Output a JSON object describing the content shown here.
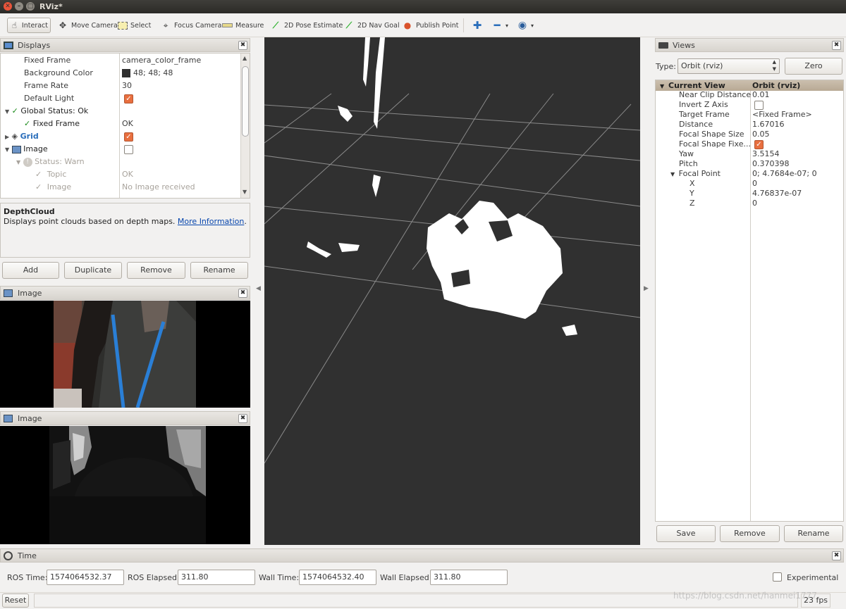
{
  "window": {
    "title": "RViz*"
  },
  "toolbar": {
    "tools": [
      {
        "label": "Interact",
        "icon": "hand-pointer-icon"
      },
      {
        "label": "Move Camera",
        "icon": "move-arrows-icon"
      },
      {
        "label": "Select",
        "icon": "select-rect-icon"
      },
      {
        "label": "Focus Camera",
        "icon": "crosshair-icon"
      },
      {
        "label": "Measure",
        "icon": "ruler-icon"
      },
      {
        "label": "2D Pose Estimate",
        "icon": "green-arrow-icon"
      },
      {
        "label": "2D Nav Goal",
        "icon": "green-arrow-icon"
      },
      {
        "label": "Publish Point",
        "icon": "map-pin-icon"
      }
    ]
  },
  "displays": {
    "title": "Displays",
    "rows": [
      {
        "label": "Fixed Frame",
        "value": "camera_color_frame"
      },
      {
        "label": "Background Color",
        "value": "48; 48; 48"
      },
      {
        "label": "Frame Rate",
        "value": "30"
      },
      {
        "label": "Default Light",
        "value": ""
      },
      {
        "label": "Global Status: Ok",
        "value": ""
      },
      {
        "label": "Fixed Frame",
        "value": "OK"
      },
      {
        "label": "Grid",
        "value": ""
      },
      {
        "label": "Image",
        "value": ""
      },
      {
        "label": "Status: Warn",
        "value": ""
      },
      {
        "label": "Topic",
        "value": "OK"
      },
      {
        "label": "Image",
        "value": "No Image received"
      }
    ],
    "desc_title": "DepthCloud",
    "desc_text": "Displays point clouds based on depth maps.",
    "desc_link": "More Information",
    "desc_period": ".",
    "buttons": {
      "add": "Add",
      "duplicate": "Duplicate",
      "remove": "Remove",
      "rename": "Rename"
    }
  },
  "image_panel_1": {
    "title": "Image"
  },
  "image_panel_2": {
    "title": "Image"
  },
  "views": {
    "title": "Views",
    "type_label": "Type:",
    "type_value": "Orbit (rviz)",
    "zero": "Zero",
    "header": {
      "name": "Current View",
      "value": "Orbit (rviz)"
    },
    "rows": [
      {
        "label": "Near Clip Distance",
        "value": "0.01"
      },
      {
        "label": "Invert Z Axis",
        "value": ""
      },
      {
        "label": "Target Frame",
        "value": "<Fixed Frame>"
      },
      {
        "label": "Distance",
        "value": "1.67016"
      },
      {
        "label": "Focal Shape Size",
        "value": "0.05"
      },
      {
        "label": "Focal Shape Fixe...",
        "value": ""
      },
      {
        "label": "Yaw",
        "value": "3.5154"
      },
      {
        "label": "Pitch",
        "value": "0.370398"
      },
      {
        "label": "Focal Point",
        "value": "0; 4.7684e-07; 0"
      },
      {
        "label": "X",
        "value": "0"
      },
      {
        "label": "Y",
        "value": "4.76837e-07"
      },
      {
        "label": "Z",
        "value": "0"
      }
    ],
    "buttons": {
      "save": "Save",
      "remove": "Remove",
      "rename": "Rename"
    }
  },
  "time": {
    "title": "Time",
    "ros_time_label": "ROS Time:",
    "ros_time": "1574064532.37",
    "ros_elapsed_label": "ROS Elapsed:",
    "ros_elapsed": "311.80",
    "wall_time_label": "Wall Time:",
    "wall_time": "1574064532.40",
    "wall_elapsed_label": "Wall Elapsed:",
    "wall_elapsed": "311.80",
    "experimental": "Experimental"
  },
  "status": {
    "reset": "Reset",
    "fps": "23 fps",
    "watermark": "https://blog.csdn.net/hanmei1777"
  },
  "colors": {
    "viewport_bg": "#303030",
    "checkbox_on": "#e86f3f",
    "link": "#0645ad"
  }
}
